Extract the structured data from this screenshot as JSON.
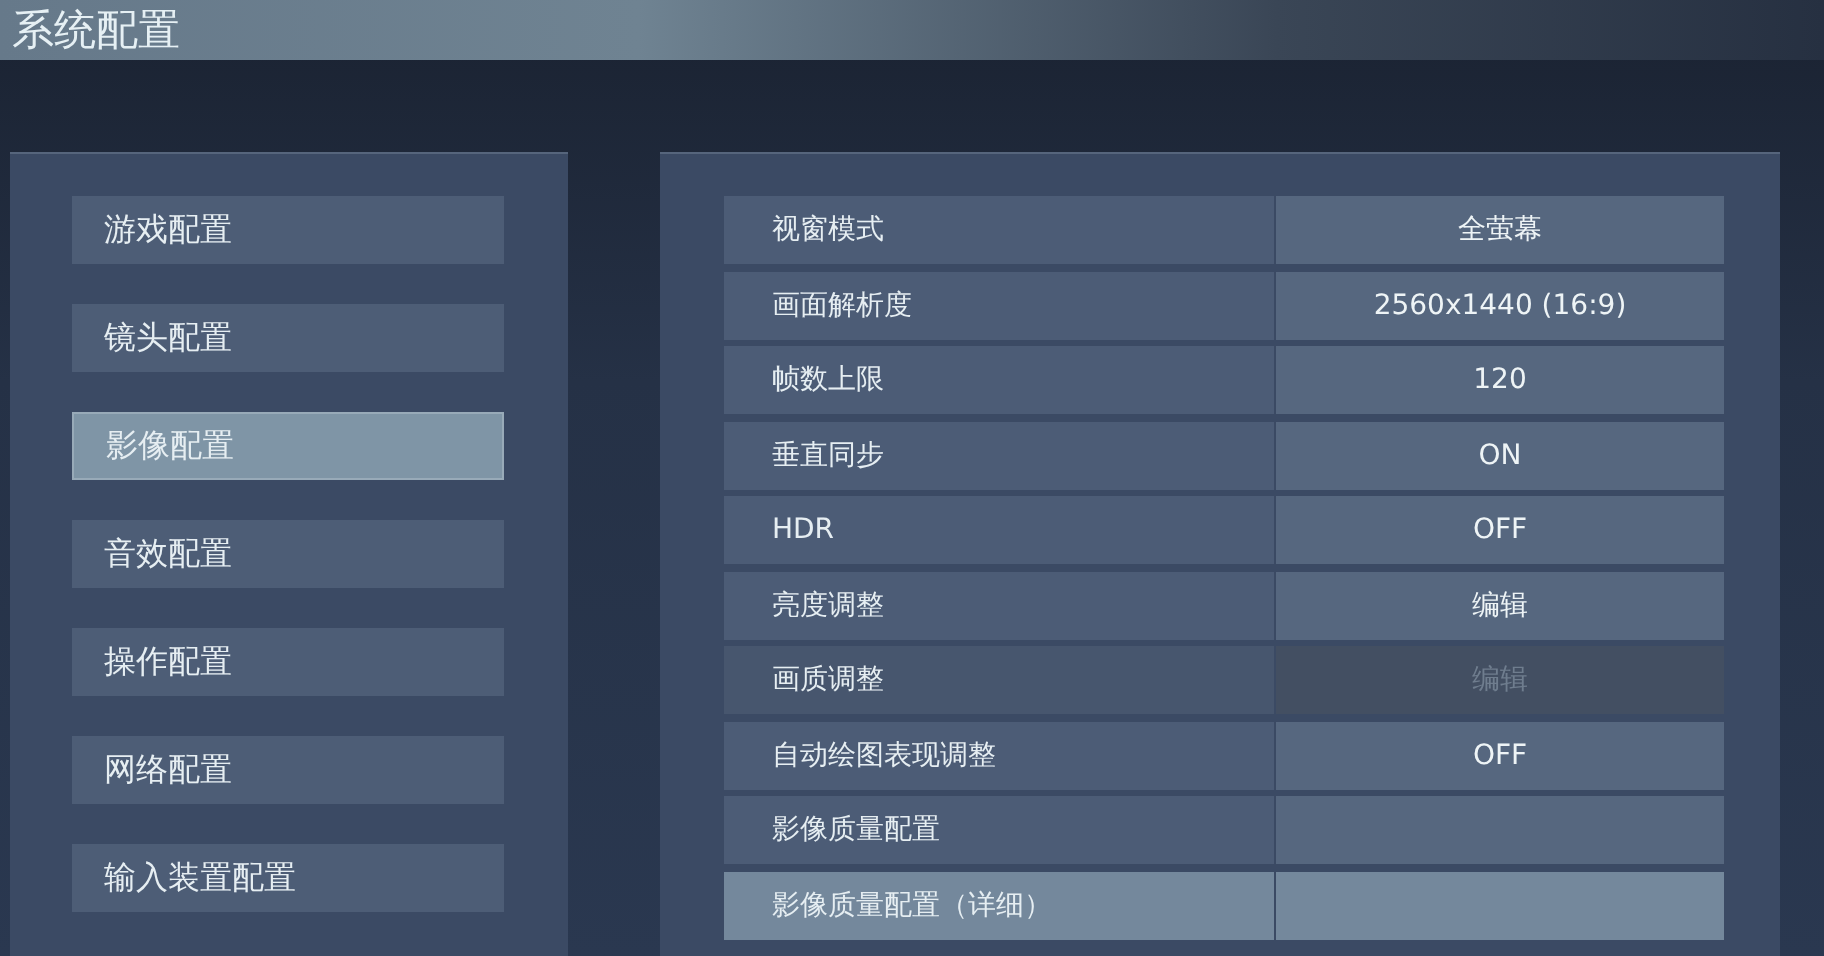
{
  "title": "系统配置",
  "menu": [
    {
      "label": "游戏配置",
      "selected": false
    },
    {
      "label": "镜头配置",
      "selected": false
    },
    {
      "label": "影像配置",
      "selected": true
    },
    {
      "label": "音效配置",
      "selected": false
    },
    {
      "label": "操作配置",
      "selected": false
    },
    {
      "label": "网络配置",
      "selected": false
    },
    {
      "label": "输入装置配置",
      "selected": false
    }
  ],
  "settings": [
    {
      "label": "视窗模式",
      "value": "全萤幕",
      "disabled": false,
      "selected": false
    },
    {
      "label": "画面解析度",
      "value": "2560x1440 (16:9)",
      "disabled": false,
      "selected": false
    },
    {
      "label": "帧数上限",
      "value": "120",
      "disabled": false,
      "selected": false
    },
    {
      "label": "垂直同步",
      "value": "ON",
      "disabled": false,
      "selected": false
    },
    {
      "label": "HDR",
      "value": "OFF",
      "disabled": false,
      "selected": false
    },
    {
      "label": "亮度调整",
      "value": "编辑",
      "disabled": false,
      "selected": false
    },
    {
      "label": "画质调整",
      "value": "编辑",
      "disabled": true,
      "selected": false
    },
    {
      "label": "自动绘图表现调整",
      "value": "OFF",
      "disabled": false,
      "selected": false
    },
    {
      "label": "影像质量配置",
      "disabled": false,
      "selected": false
    },
    {
      "label": "影像质量配置（详细）",
      "disabled": false,
      "selected": true
    }
  ]
}
